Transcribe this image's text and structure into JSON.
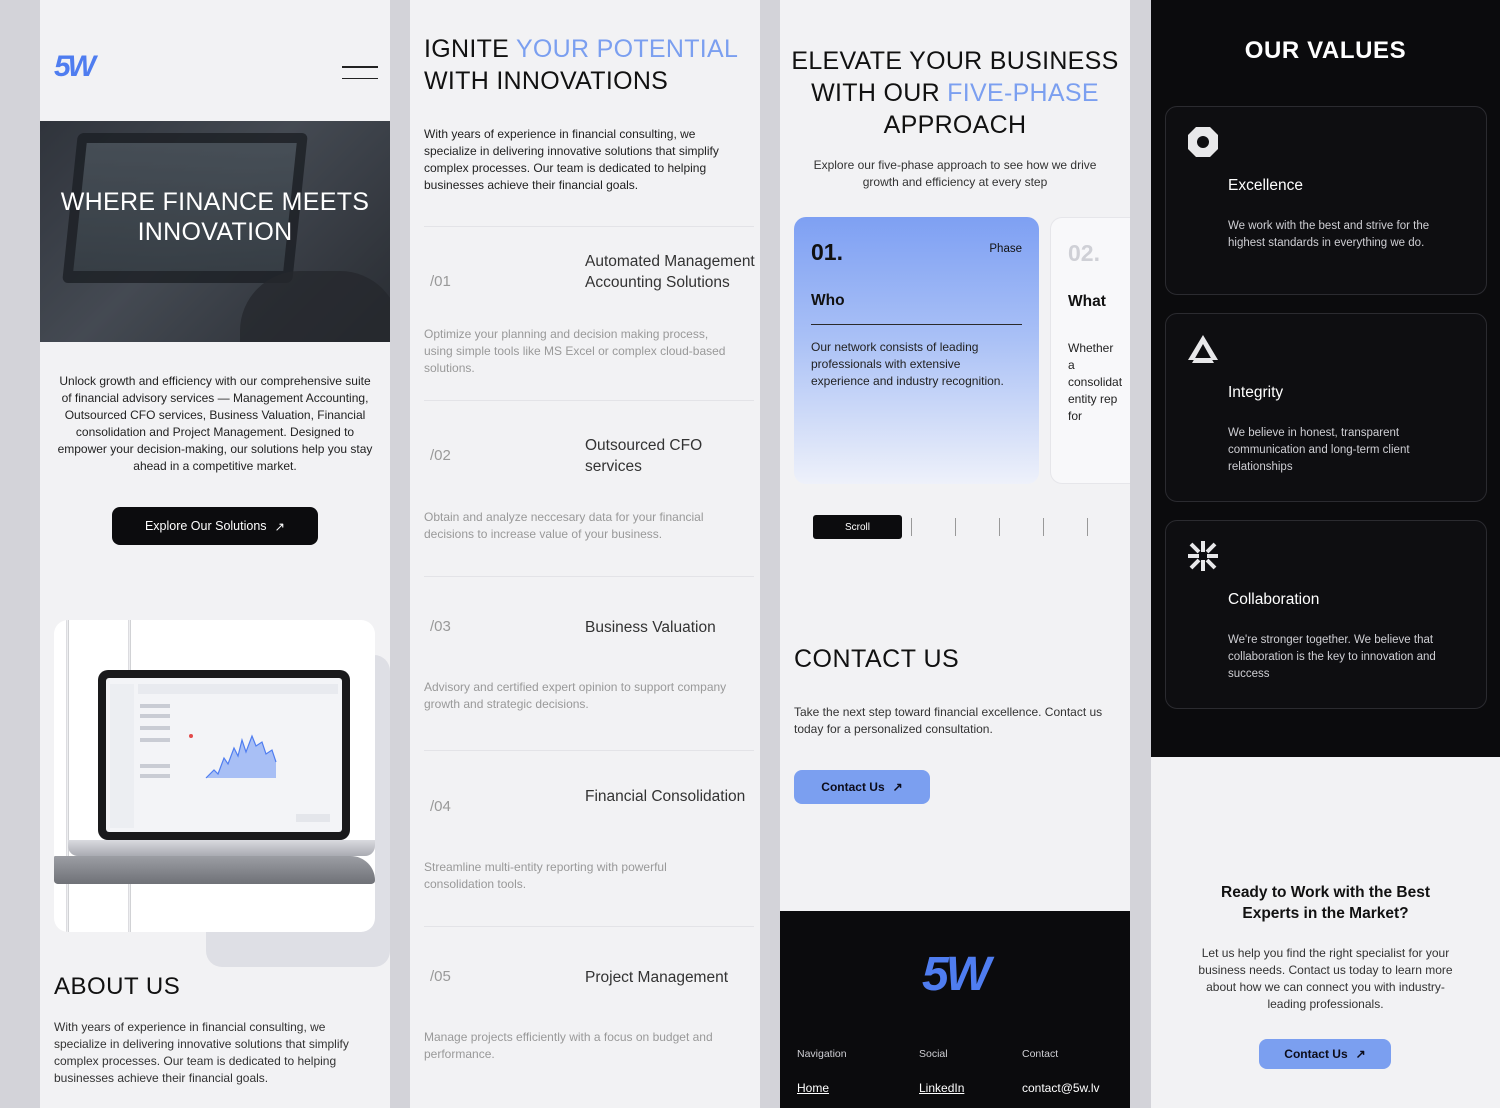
{
  "brand": {
    "logo_text": "5W",
    "accent": "#7b9ff0",
    "logo_color": "#4f7df0"
  },
  "col1": {
    "menu_icon": "hamburger-icon",
    "hero_title": "WHERE FINANCE MEETS INNOVATION",
    "intro": "Unlock growth and efficiency with our comprehensive suite of financial advisory services — Management Accounting, Outsourced CFO services, Business Valuation, Financial consolidation and Project Management. Designed to empower your decision-making, our solutions help you stay ahead in a competitive market.",
    "cta_label": "Explore Our Solutions",
    "cta_icon": "arrow-up-right-icon",
    "about_title": "ABOUT US",
    "about_text": "With years of experience in financial consulting, we specialize in delivering innovative solutions that simplify complex processes. Our team is dedicated to helping businesses achieve their financial goals."
  },
  "col2": {
    "title_part1": "IGNITE ",
    "title_accent": "YOUR POTENTIAL",
    "title_part2": "WITH INNOVATIONS",
    "intro": "With years of experience in financial consulting, we specialize in delivering innovative solutions that simplify complex processes. Our team is dedicated to helping businesses achieve their financial goals.",
    "services": [
      {
        "num": "/01",
        "title": "Automated Management Accounting Solutions",
        "desc": "Optimize your planning and decision making process, using simple tools like MS Excel or complex cloud-based solutions."
      },
      {
        "num": "/02",
        "title": "Outsourced CFO services",
        "desc": "Obtain and analyze neccesary data for your financial decisions to increase value of your business."
      },
      {
        "num": "/03",
        "title": "Business Valuation",
        "desc": "Advisory and certified expert opinion to support company growth and strategic decisions."
      },
      {
        "num": "/04",
        "title": "Financial Consolidation",
        "desc": "Streamline multi-entity reporting with powerful consolidation tools."
      },
      {
        "num": "/05",
        "title": "Project Management",
        "desc": "Manage projects efficiently with a focus on budget and performance."
      }
    ]
  },
  "col3": {
    "title_part1": "ELEVATE YOUR BUSINESS WITH OUR ",
    "title_accent": "FIVE-PHASE",
    "title_part2": "APPROACH",
    "intro": "Explore our five-phase approach to see how we drive growth and efficiency at every step",
    "phases": [
      {
        "num": "01.",
        "label": "Phase",
        "title": "Who",
        "desc": "Our network consists of leading professionals with extensive experience and industry recognition."
      },
      {
        "num": "02.",
        "title": "What",
        "desc": "Whether a consolidated entity rep for strateg with the r"
      }
    ],
    "scroll_label": "Scroll",
    "contact_title": "CONTACT US",
    "contact_text": "Take the next step toward financial excellence. Contact us today for a personalized consultation.",
    "contact_btn": "Contact Us",
    "footer": {
      "nav_head": "Navigation",
      "social_head": "Social",
      "contact_head": "Contact",
      "nav_link": "Home",
      "social_link": "LinkedIn",
      "contact_link": "contact@5w.lv"
    }
  },
  "col4": {
    "values_title": "OUR VALUES",
    "values": [
      {
        "icon": "octagon-ring-icon",
        "title": "Excellence",
        "desc": "We work with the best and strive for the highest standards in everything we do."
      },
      {
        "icon": "triangle-icon",
        "title": "Integrity",
        "desc": "We believe in honest, transparent communication and long-term client relationships"
      },
      {
        "icon": "asterisk-icon",
        "title": "Collaboration",
        "desc": "We're stronger together. We believe that collaboration is the key to innovation and success"
      }
    ],
    "ready_title": "Ready to Work with the Best Experts in the Market?",
    "ready_text": "Let us help you find the right specialist for your business needs. Contact us today to learn more about how we can connect you with industry-leading professionals.",
    "ready_btn": "Contact Us"
  }
}
